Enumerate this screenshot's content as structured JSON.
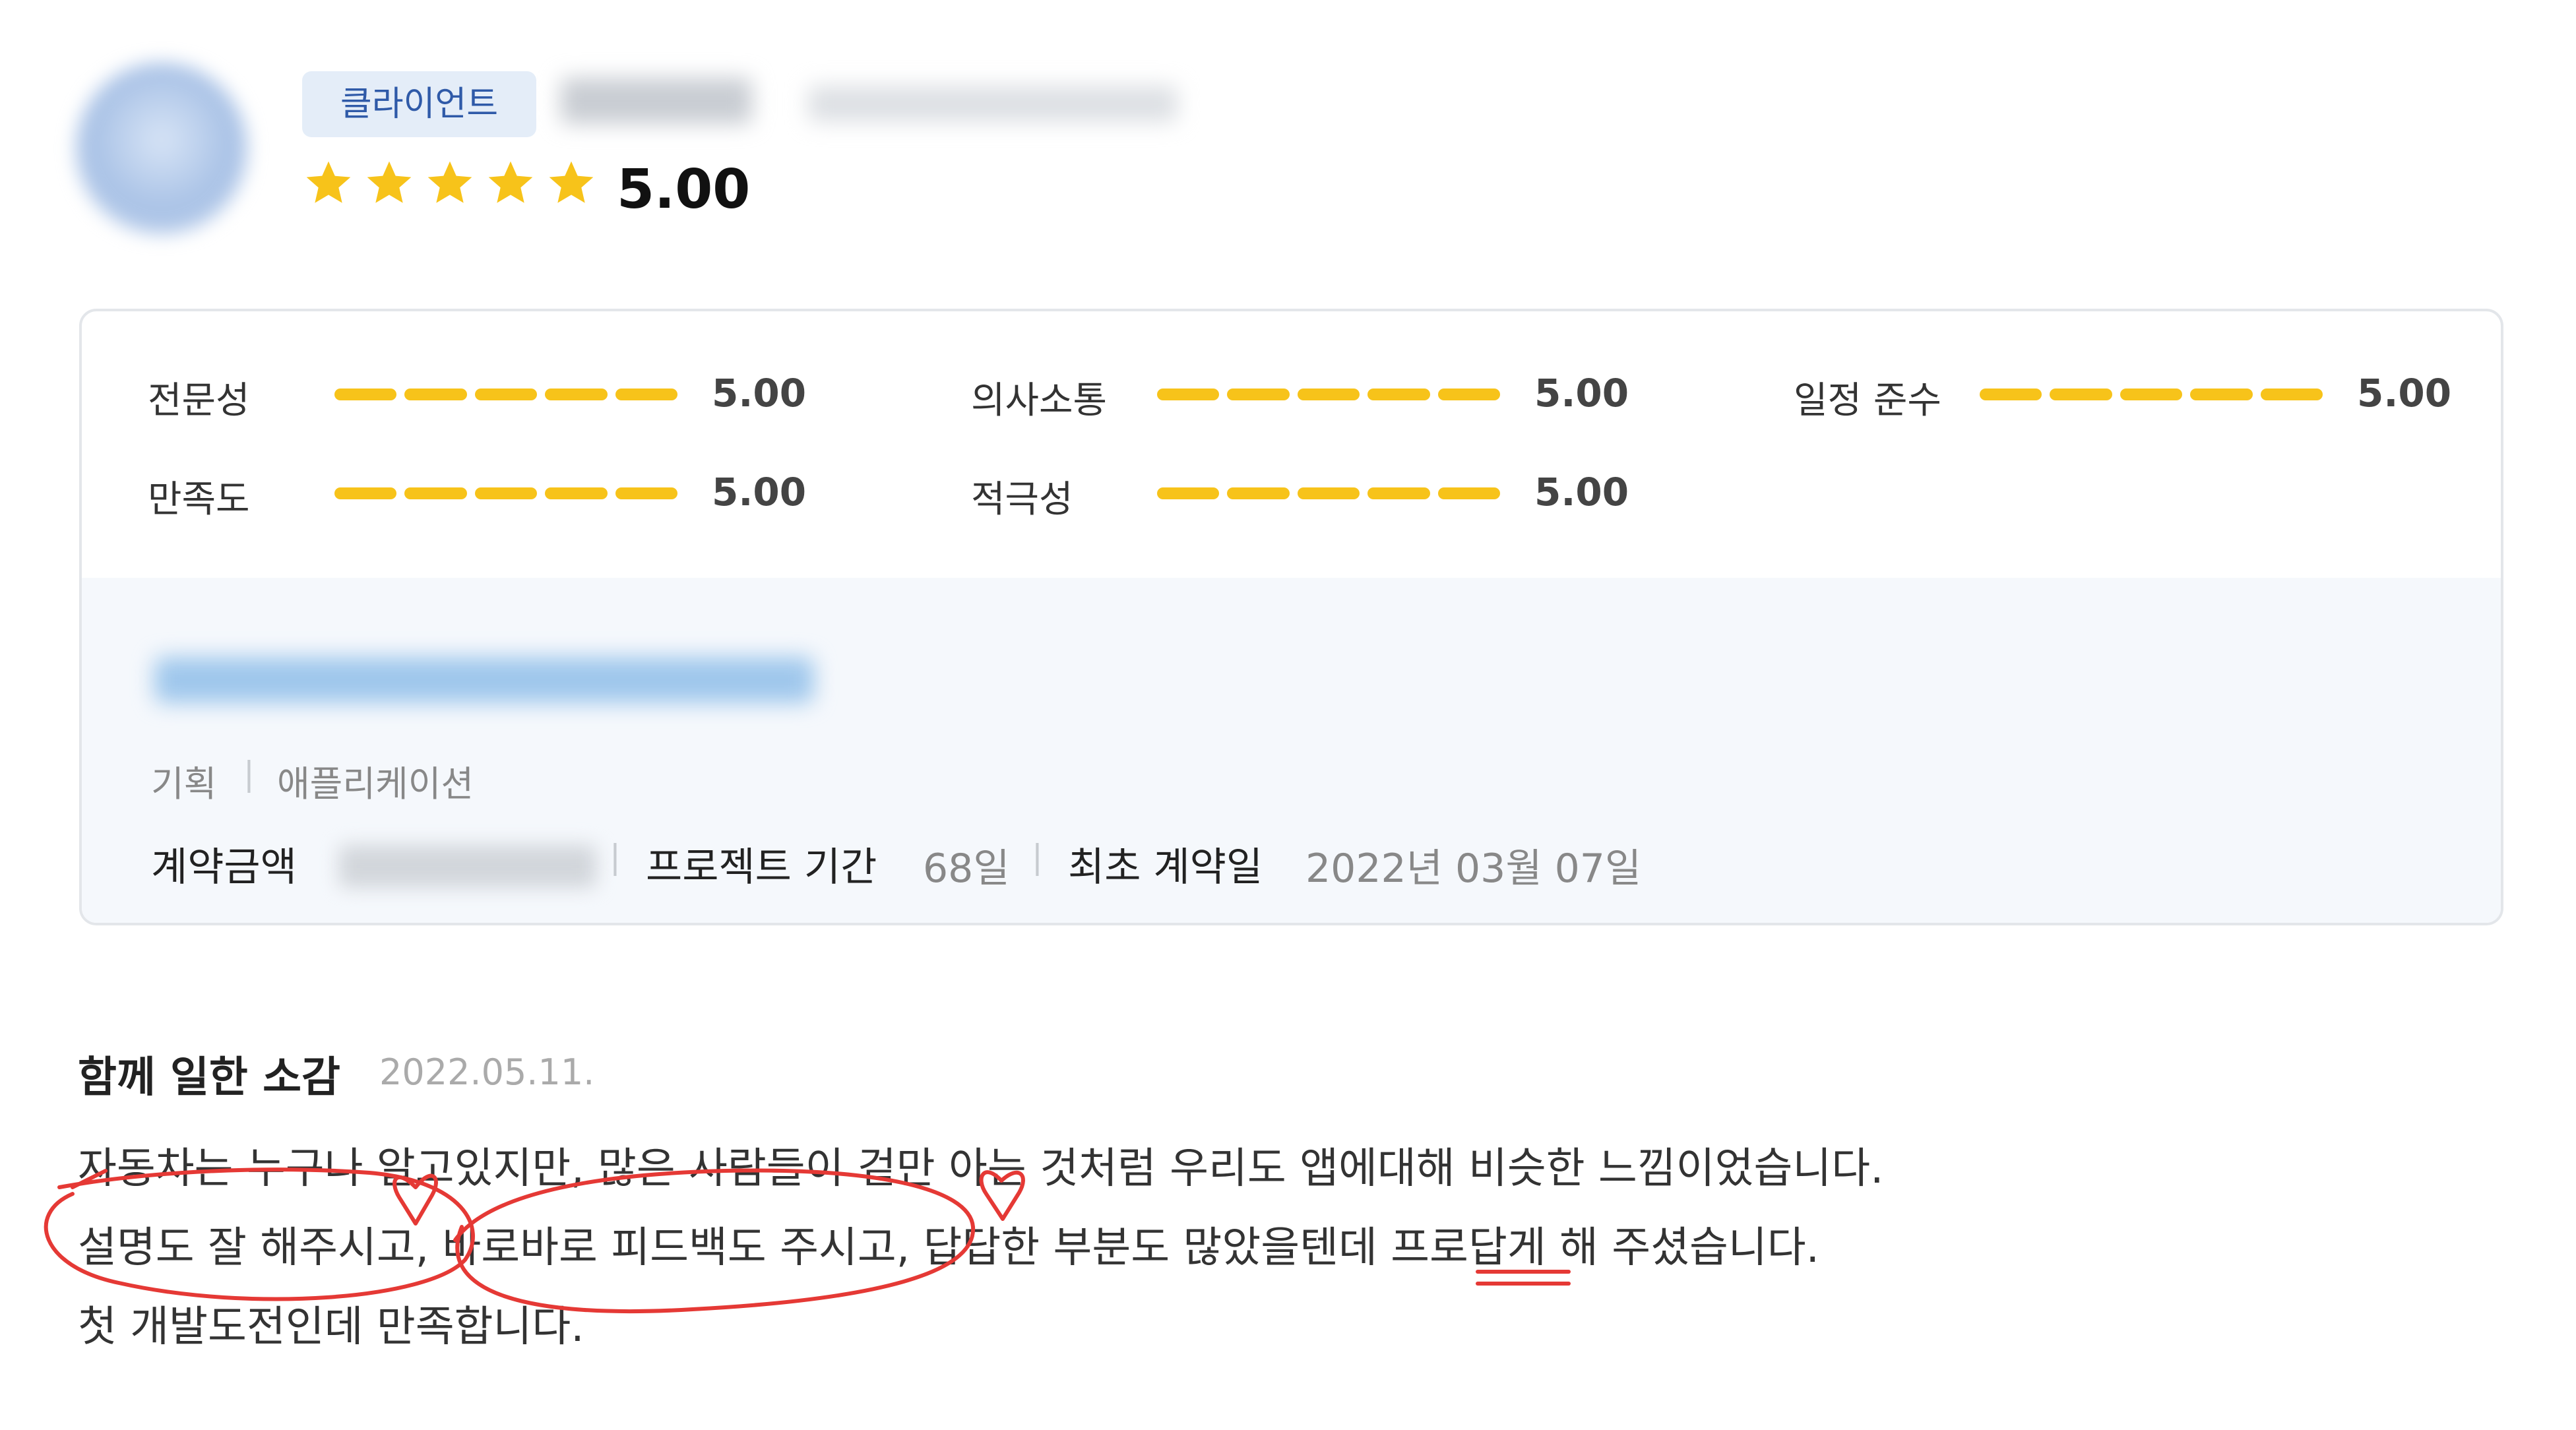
{
  "header": {
    "role_badge": "클라이언트",
    "rating": "5.00",
    "star_count": 5,
    "star_color": "#f7c31a"
  },
  "scores": [
    {
      "label": "전문성",
      "value": "5.00"
    },
    {
      "label": "의사소통",
      "value": "5.00"
    },
    {
      "label": "일정 준수",
      "value": "5.00"
    },
    {
      "label": "만족도",
      "value": "5.00"
    },
    {
      "label": "적극성",
      "value": "5.00"
    }
  ],
  "project": {
    "categories": [
      "기획",
      "애플리케이션"
    ],
    "contract_amount_label": "계약금액",
    "duration_label": "프로젝트 기간",
    "duration_value": "68일",
    "first_contract_label": "최초 계약일",
    "first_contract_value": "2022년 03월 07일"
  },
  "review": {
    "title": "함께 일한 소감",
    "date": "2022.05.11.",
    "lines": [
      "자동차는 누구나 알고있지만, 많은 사람들이 겉만 아는 것처럼 우리도 앱에대해 비슷한 느낌이었습니다.",
      "설명도 잘 해주시고, 바로바로 피드백도 주시고, 답답한 부분도 많았을텐데 프로답게 해 주셨습니다.",
      "첫 개발도전인데 만족합니다."
    ]
  },
  "colors": {
    "accent_yellow": "#f7c31a",
    "badge_text": "#2f5aa8",
    "annotation_red": "#e53935"
  }
}
